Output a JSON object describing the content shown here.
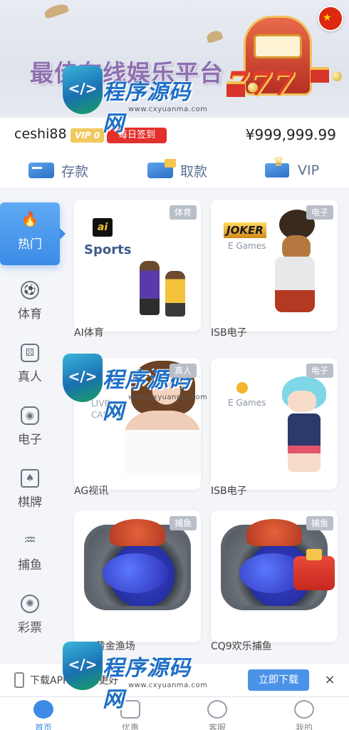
{
  "banner": {
    "title": "最佳在线娱乐平台"
  },
  "watermark": {
    "brand": "程序源码网",
    "url": "www.cxyuanma.com",
    "shield_label": "</>"
  },
  "user": {
    "username": "ceshi88",
    "vip_badge": "VIP 0",
    "signin_label": "每日签到",
    "balance": "¥999,999.99"
  },
  "actions": [
    {
      "label": "存款",
      "icon": "card-icon"
    },
    {
      "label": "取款",
      "icon": "wallet-icon"
    },
    {
      "label": "VIP",
      "icon": "crown-icon"
    }
  ],
  "sidebar": {
    "items": [
      {
        "label": "热门",
        "icon": "fire-icon"
      },
      {
        "label": "体育",
        "icon": "soccer-icon"
      },
      {
        "label": "真人",
        "icon": "dice-icon"
      },
      {
        "label": "电子",
        "icon": "gamepad-icon"
      },
      {
        "label": "棋牌",
        "icon": "cards-icon"
      },
      {
        "label": "捕鱼",
        "icon": "fish-icon"
      },
      {
        "label": "彩票",
        "icon": "lottery-ball-icon"
      }
    ]
  },
  "games": [
    {
      "name": "AI体育",
      "tag": "体育",
      "logo": "ai",
      "logo_text": "Sports"
    },
    {
      "name": "ISB电子",
      "tag": "电子",
      "logo": "JOKER",
      "logo_text": "E Games"
    },
    {
      "name": "AG视讯",
      "tag": "真人",
      "logo": "",
      "logo_text": "LIVE\nCASINO"
    },
    {
      "name": "ISB电子",
      "tag": "电子",
      "logo": "",
      "logo_text": "E Games"
    },
    {
      "name": "CQ9黄金渔场",
      "tag": "捕鱼",
      "logo": "",
      "logo_text": ""
    },
    {
      "name": "CQ9欢乐捕鱼",
      "tag": "捕鱼",
      "logo": "",
      "logo_text": ""
    }
  ],
  "download": {
    "text": "下载APP，体验更好",
    "button": "立即下载",
    "close": "×"
  },
  "bottom_nav": [
    {
      "label": "首页",
      "icon": "home-icon"
    },
    {
      "label": "优惠",
      "icon": "gift-icon"
    },
    {
      "label": "客服",
      "icon": "support-icon"
    },
    {
      "label": "我的",
      "icon": "profile-icon"
    }
  ],
  "fab_close": "×",
  "colors": {
    "accent": "#3c8be6",
    "signin": "#e2302c",
    "vip": "#f1c95e"
  }
}
